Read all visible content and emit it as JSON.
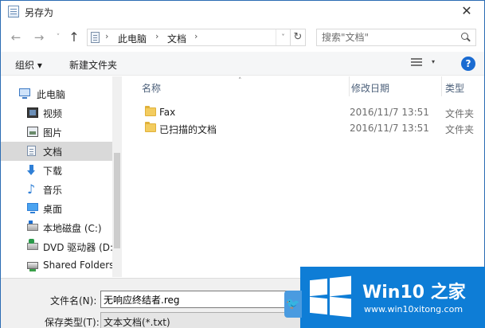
{
  "window": {
    "title": "另存为",
    "close_glyph": "✕"
  },
  "nav": {
    "back": "←",
    "forward": "→",
    "recent": "˅",
    "up": "↑",
    "breadcrumbs": [
      "此电脑",
      "文档"
    ],
    "crumb_sep": "›",
    "address_dropdown": "˅",
    "refresh": "↻",
    "search_placeholder": "搜索\"文档\""
  },
  "toolbar": {
    "organize": "组织 ▾",
    "new_folder": "新建文件夹",
    "view_dropdown": "▾",
    "help": "?"
  },
  "sidebar": {
    "items": [
      {
        "label": "此电脑",
        "icon": "pc-icon"
      },
      {
        "label": "视频",
        "icon": "video-icon"
      },
      {
        "label": "图片",
        "icon": "picture-icon"
      },
      {
        "label": "文档",
        "icon": "document-icon",
        "selected": true
      },
      {
        "label": "下载",
        "icon": "download-icon"
      },
      {
        "label": "音乐",
        "icon": "music-icon"
      },
      {
        "label": "桌面",
        "icon": "desktop-icon"
      },
      {
        "label": "本地磁盘 (C:)",
        "icon": "disk-icon"
      },
      {
        "label": "DVD 驱动器 (D:",
        "icon": "dvd-icon"
      },
      {
        "label": "Shared Folders",
        "icon": "shared-folder-icon"
      }
    ]
  },
  "file_list": {
    "columns": {
      "name": "名称",
      "date": "修改日期",
      "type": "类型"
    },
    "sort_caret": "˄",
    "rows": [
      {
        "name": "Fax",
        "date": "2016/11/7 13:51",
        "type": "文件夹"
      },
      {
        "name": "已扫描的文档",
        "date": "2016/11/7 13:51",
        "type": "文件夹"
      }
    ]
  },
  "save_form": {
    "filename_label": "文件名(N):",
    "filename_value": "无响应终结者.reg",
    "filetype_label": "保存类型(T):",
    "filetype_value": "文本文档(*.txt)"
  },
  "watermark": {
    "title": "Win10 之家",
    "url": "www.win10xitong.com",
    "bird": "🐦"
  },
  "colors": {
    "accent": "#0e7dd6",
    "folder": "#f3cc5f",
    "selected": "#d9d9d9",
    "help": "#1a6bd1"
  }
}
